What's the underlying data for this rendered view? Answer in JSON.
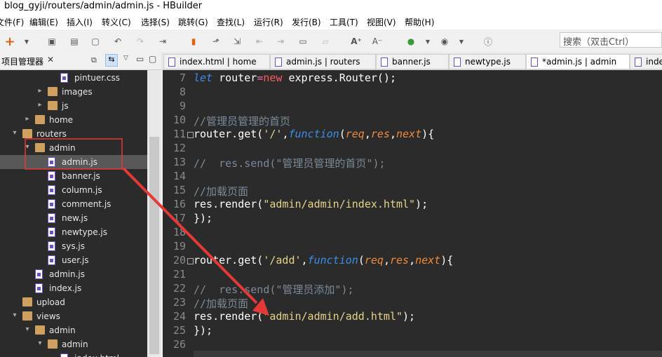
{
  "window": {
    "title": "blog_gyji/routers/admin/admin.js  -  HBuilder"
  },
  "menu": [
    "文件(F)",
    "编辑(E)",
    "插入(I)",
    "转义(C)",
    "选择(S)",
    "跳转(G)",
    "查找(L)",
    "运行(R)",
    "发行(B)",
    "工具(T)",
    "视图(V)",
    "帮助(H)"
  ],
  "search": {
    "placeholder": "搜索（双击Ctrl）"
  },
  "sidebar": {
    "title": "项目管理器",
    "tree": [
      {
        "label": "pintuer.css",
        "type": "file",
        "level": 4
      },
      {
        "label": "images",
        "type": "folder",
        "level": 3,
        "twisty": "▸"
      },
      {
        "label": "js",
        "type": "folder",
        "level": 3,
        "twisty": "▸"
      },
      {
        "label": "home",
        "type": "folder",
        "level": 2,
        "twisty": "▸"
      },
      {
        "label": "routers",
        "type": "folder",
        "level": 1,
        "twisty": "▾"
      },
      {
        "label": "admin",
        "type": "folder",
        "level": 2,
        "twisty": "▾"
      },
      {
        "label": "admin.js",
        "type": "file",
        "level": 3,
        "selected": true
      },
      {
        "label": "banner.js",
        "type": "file",
        "level": 3
      },
      {
        "label": "column.js",
        "type": "file",
        "level": 3
      },
      {
        "label": "comment.js",
        "type": "file",
        "level": 3
      },
      {
        "label": "new.js",
        "type": "file",
        "level": 3
      },
      {
        "label": "newtype.js",
        "type": "file",
        "level": 3
      },
      {
        "label": "sys.js",
        "type": "file",
        "level": 3
      },
      {
        "label": "user.js",
        "type": "file",
        "level": 3
      },
      {
        "label": "admin.js",
        "type": "file",
        "level": 2
      },
      {
        "label": "index.js",
        "type": "file",
        "level": 2
      },
      {
        "label": "upload",
        "type": "folder",
        "level": 1,
        "twisty": ""
      },
      {
        "label": "views",
        "type": "folder",
        "level": 1,
        "twisty": "▾"
      },
      {
        "label": "admin",
        "type": "folder",
        "level": 2,
        "twisty": "▾"
      },
      {
        "label": "admin",
        "type": "folder",
        "level": 3,
        "twisty": "▾"
      },
      {
        "label": "index.html",
        "type": "file",
        "level": 4
      }
    ]
  },
  "tabs": [
    {
      "label": "index.html | home",
      "active": false
    },
    {
      "label": "admin.js | routers",
      "active": false
    },
    {
      "label": "banner.js",
      "active": false
    },
    {
      "label": "newtype.js",
      "active": false
    },
    {
      "label": "*admin.js | admin",
      "active": true
    },
    {
      "label": "inde",
      "active": false
    }
  ],
  "code_lines": [
    {
      "n": "7",
      "html": "<span class=\"kw\">let</span> router<span class=\"op\">=</span><span class=\"fn\">new</span> express.Router();"
    },
    {
      "n": "8",
      "html": ""
    },
    {
      "n": "9",
      "html": ""
    },
    {
      "n": "10",
      "html": "<span class=\"cm\">//管理员管理的首页</span>"
    },
    {
      "n": "11",
      "html": "router.get(<span class=\"str\">'/'</span>,<span class=\"kw\">function</span>(<span class=\"par\">req</span>,<span class=\"par\">res</span>,<span class=\"par\">next</span>){",
      "fold": true
    },
    {
      "n": "12",
      "html": ""
    },
    {
      "n": "13",
      "html": "<span class=\"cm\">//  res.send(\"管理员管理的首页\");</span>"
    },
    {
      "n": "14",
      "html": ""
    },
    {
      "n": "15",
      "html": "<span class=\"cm\">//加载页面</span>"
    },
    {
      "n": "16",
      "html": "res.render(<span class=\"str\">\"admin/admin/index.html\"</span>);"
    },
    {
      "n": "17",
      "html": "});"
    },
    {
      "n": "18",
      "html": ""
    },
    {
      "n": "19",
      "html": ""
    },
    {
      "n": "20",
      "html": "router.get(<span class=\"str\">'/add'</span>,<span class=\"kw\">function</span>(<span class=\"par\">req</span>,<span class=\"par\">res</span>,<span class=\"par\">next</span>){",
      "fold": true
    },
    {
      "n": "21",
      "html": ""
    },
    {
      "n": "22",
      "html": "<span class=\"cm\">//  res.send(\"管理员添加\");</span>"
    },
    {
      "n": "23",
      "html": "<span class=\"cm\">//加载页面</span>"
    },
    {
      "n": "24",
      "html": "res.render(<span class=\"str\">\"admin/admin/add.html\"</span>);"
    },
    {
      "n": "25",
      "html": "});"
    },
    {
      "n": "26",
      "html": ""
    }
  ],
  "colors": {
    "annotation": "#e53935",
    "editor_bg": "#2b2b2b"
  }
}
